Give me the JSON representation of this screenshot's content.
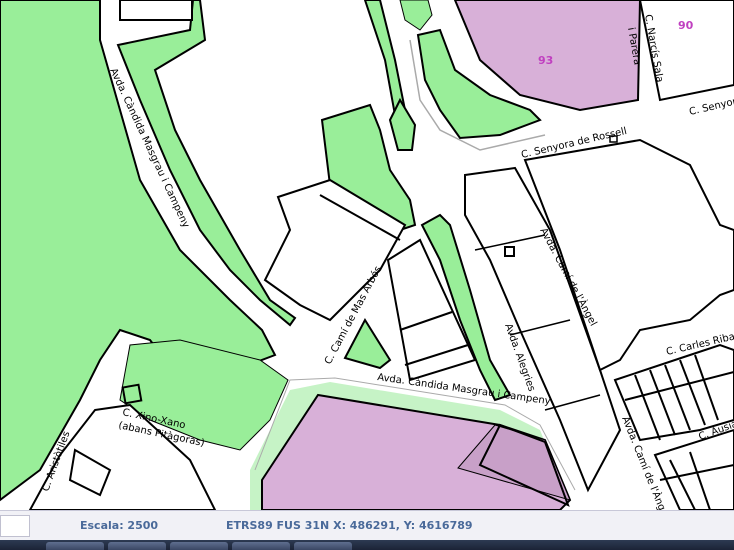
{
  "map": {
    "streets": [
      {
        "id": "avda-candida-masgrau-west",
        "label": "Avda. Càndida Masgrau i Campeny"
      },
      {
        "id": "c-narcis-sala",
        "label": "C. Narcís Sala"
      },
      {
        "id": "i-parera",
        "label": "i Parera"
      },
      {
        "id": "c-senyora-rossell",
        "label": "C. Senyora de Rossell"
      },
      {
        "id": "c-senyora-east",
        "label": "C. Senyora"
      },
      {
        "id": "avda-cami-angel-north",
        "label": "Avda. Camí de l'Àngel"
      },
      {
        "id": "c-cami-mas-arbos",
        "label": "C. Camí de Mas Arbós"
      },
      {
        "id": "avda-alegries",
        "label": "Avda. Alegries"
      },
      {
        "id": "c-carles-riba",
        "label": "C. Carles Riba"
      },
      {
        "id": "avda-candida-masgrau-south",
        "label": "Avda. Càndida Masgrau i Campeny"
      },
      {
        "id": "c-xino-xano",
        "label": "C. Xino-Xano"
      },
      {
        "id": "abans-pitagores",
        "label": "(abans Pitàgoras)"
      },
      {
        "id": "c-aristoteles",
        "label": "C. Aristòtiles"
      },
      {
        "id": "c-ausias",
        "label": "C. Ausiàs"
      },
      {
        "id": "avda-cami-angel-south",
        "label": "Avda. Camí de l'Àngel"
      }
    ],
    "parcels": [
      {
        "id": "parcel-93",
        "label": "93"
      },
      {
        "id": "parcel-90",
        "label": "90"
      }
    ],
    "colors": {
      "green_zone": "#99ee99",
      "purple_zone": "#d8b0d8",
      "light_green": "#c6f3c6",
      "outline": "#000000",
      "label_purple": "#c040c0"
    }
  },
  "status": {
    "scale": "Escala: 2500",
    "coords": "ETRS89 FUS 31N X: 486291,   Y: 4616789"
  }
}
